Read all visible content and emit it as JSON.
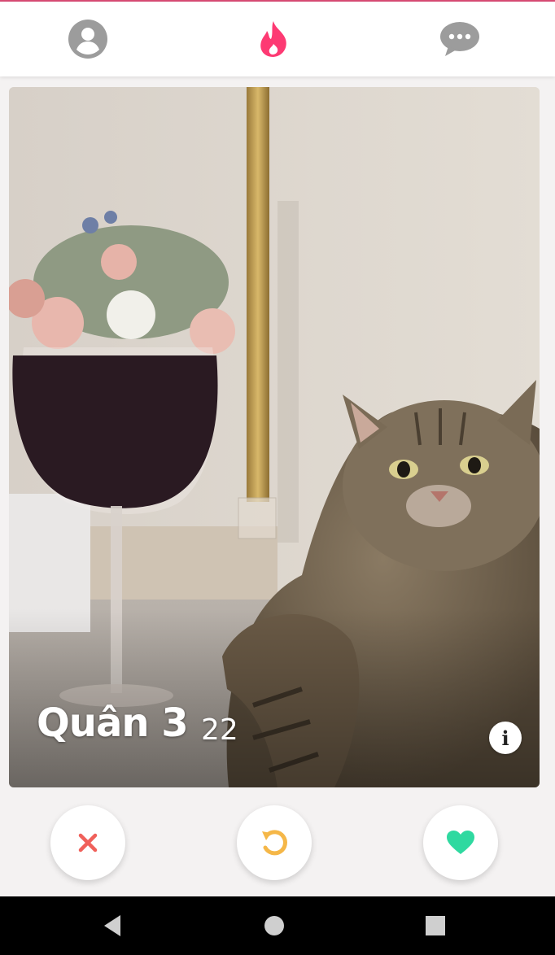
{
  "colors": {
    "brand_accent": "#fd3a73",
    "inactive_icon": "#9c9c9c",
    "nope": "#f0605a",
    "rewind": "#f5b748",
    "like": "#2fd9a0"
  },
  "topbar": {
    "icons": [
      "profile-icon",
      "flame-icon",
      "chat-icon"
    ],
    "active_tab": "flame-icon"
  },
  "card": {
    "name": "Quân 3",
    "age": "22",
    "photo_subject": "cat-photo",
    "info_icon": "info-icon"
  },
  "actions": {
    "icons": [
      "close-icon",
      "rewind-icon",
      "heart-icon"
    ]
  },
  "system_nav": {
    "icons": [
      "back-triangle-icon",
      "home-circle-icon",
      "recents-square-icon"
    ]
  }
}
